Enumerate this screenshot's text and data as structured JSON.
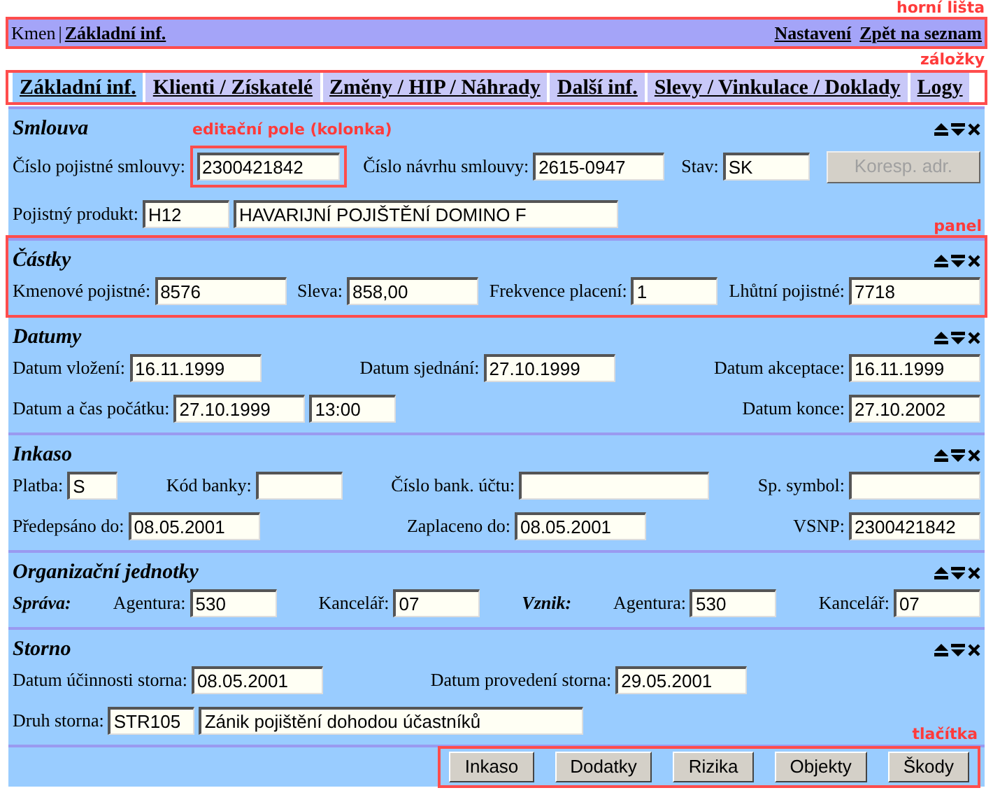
{
  "top_bar": {
    "annotation": "horní lišta",
    "crumbs": [
      {
        "text": "Kmen",
        "kind": "text"
      },
      {
        "text": "|",
        "kind": "text"
      },
      {
        "text": "Základní inf.",
        "kind": "link"
      }
    ],
    "links": [
      "Nastavení",
      "Zpět na seznam"
    ]
  },
  "tabs": {
    "annotation": "záložky",
    "items": [
      {
        "label": "Základní inf.",
        "selected": true
      },
      {
        "label": "Klienti / Získatelé",
        "selected": false
      },
      {
        "label": "Změny / HIP / Náhrady",
        "selected": false
      },
      {
        "label": "Další inf.",
        "selected": false
      },
      {
        "label": "Slevy / Vinkulace / Doklady",
        "selected": false
      },
      {
        "label": "Logy",
        "selected": false
      }
    ]
  },
  "panels": [
    {
      "title": "Smlouva",
      "rows": [
        {
          "items": [
            {
              "kind": "field",
              "label": "Číslo pojistné smlouvy:",
              "inputs": [
                {
                  "value": "2300421842",
                  "kind": "long",
                  "annotation": "editační pole (kolonka)"
                }
              ]
            },
            {
              "kind": "field",
              "label": "Číslo návrhu smlouvy:",
              "inputs": [
                {
                  "value": "2615-0947",
                  "kind": "medium"
                }
              ]
            },
            {
              "kind": "field",
              "label": "Stav:",
              "inputs": [
                {
                  "value": "SK",
                  "kind": "short"
                }
              ]
            },
            {
              "kind": "button",
              "label": "Koresp. adr.",
              "disabled": true
            }
          ]
        },
        {
          "items": [
            {
              "kind": "field",
              "label": "Pojistný produkt:",
              "inputs": [
                {
                  "value": "H12",
                  "kind": "short"
                },
                {
                  "value": "HAVARIJNÍ POJIŠTĚNÍ DOMINO F",
                  "kind": "full"
                }
              ]
            }
          ]
        }
      ]
    },
    {
      "title": "Částky",
      "annotation": "panel",
      "rows": [
        {
          "items": [
            {
              "kind": "field",
              "label": "Kmenové pojistné:",
              "inputs": [
                {
                  "value": "8576",
                  "kind": "medium"
                }
              ]
            },
            {
              "kind": "field",
              "label": "Sleva:",
              "inputs": [
                {
                  "value": "858,00",
                  "kind": "medium"
                }
              ]
            },
            {
              "kind": "field",
              "label": "Frekvence placení:",
              "inputs": [
                {
                  "value": "1",
                  "kind": "short"
                }
              ]
            },
            {
              "kind": "field",
              "label": "Lhůtní pojistné:",
              "inputs": [
                {
                  "value": "7718",
                  "kind": "medium"
                }
              ]
            }
          ]
        }
      ]
    },
    {
      "title": "Datumy",
      "rows": [
        {
          "items": [
            {
              "kind": "field",
              "label": "Datum vložení:",
              "inputs": [
                {
                  "value": "16.11.1999",
                  "kind": "medium"
                }
              ]
            },
            {
              "kind": "field",
              "label": "Datum sjednání:",
              "inputs": [
                {
                  "value": "27.10.1999",
                  "kind": "medium"
                }
              ]
            },
            {
              "kind": "field",
              "label": "Datum akceptace:",
              "inputs": [
                {
                  "value": "16.11.1999",
                  "kind": "medium"
                }
              ]
            }
          ]
        },
        {
          "items": [
            {
              "kind": "field",
              "label": "Datum a čas počátku:",
              "inputs": [
                {
                  "value": "27.10.1999",
                  "kind": "medium"
                },
                {
                  "value": "13:00",
                  "kind": "short"
                }
              ]
            },
            {
              "kind": "field",
              "label": "Datum konce:",
              "inputs": [
                {
                  "value": "27.10.2002",
                  "kind": "medium"
                }
              ]
            }
          ]
        }
      ]
    },
    {
      "title": "Inkaso",
      "rows": [
        {
          "items": [
            {
              "kind": "field",
              "label": "Platba:",
              "inputs": [
                {
                  "value": "S",
                  "kind": "tiny"
                }
              ]
            },
            {
              "kind": "field",
              "label": "Kód banky:",
              "inputs": [
                {
                  "kind": "short"
                }
              ]
            },
            {
              "kind": "field",
              "label": "Číslo bank. účtu:",
              "inputs": [
                {
                  "kind": "wide"
                }
              ]
            },
            {
              "kind": "field",
              "label": "Sp. symbol:",
              "inputs": [
                {
                  "kind": "medium"
                }
              ]
            }
          ]
        },
        {
          "items": [
            {
              "kind": "field",
              "label": "Předepsáno do:",
              "inputs": [
                {
                  "value": "08.05.2001",
                  "kind": "medium"
                }
              ]
            },
            {
              "kind": "field",
              "label": "Zaplaceno do:",
              "inputs": [
                {
                  "value": "08.05.2001",
                  "kind": "medium"
                }
              ]
            },
            {
              "kind": "field",
              "label": "VSNP:",
              "inputs": [
                {
                  "value": "2300421842",
                  "kind": "medium"
                }
              ]
            }
          ]
        }
      ]
    },
    {
      "title": "Organizační jednotky",
      "rows": [
        {
          "items": [
            {
              "kind": "heading",
              "label": "Správa:"
            },
            {
              "kind": "field",
              "label": "Agentura:",
              "inputs": [
                {
                  "value": "530",
                  "kind": "short"
                }
              ]
            },
            {
              "kind": "field",
              "label": "Kancelář:",
              "inputs": [
                {
                  "value": "07",
                  "kind": "short"
                }
              ]
            },
            {
              "kind": "heading",
              "label": "Vznik:"
            },
            {
              "kind": "field",
              "label": "Agentura:",
              "inputs": [
                {
                  "value": "530",
                  "kind": "short"
                }
              ]
            },
            {
              "kind": "field",
              "label": "Kancelář:",
              "inputs": [
                {
                  "value": "07",
                  "kind": "short"
                }
              ]
            }
          ]
        }
      ]
    },
    {
      "title": "Storno",
      "rows": [
        {
          "items": [
            {
              "kind": "field",
              "label": "Datum účinnosti storna:",
              "inputs": [
                {
                  "value": "08.05.2001",
                  "kind": "medium"
                }
              ]
            },
            {
              "kind": "field",
              "label": "Datum provedení storna:",
              "inputs": [
                {
                  "value": "29.05.2001",
                  "kind": "medium"
                }
              ]
            },
            {
              "kind": "spacer"
            }
          ]
        },
        {
          "items": [
            {
              "kind": "field",
              "label": "Druh storna:",
              "inputs": [
                {
                  "value": "STR105",
                  "kind": "short"
                },
                {
                  "value": "Zánik pojištění dohodou účastníků",
                  "kind": "full"
                }
              ]
            }
          ]
        }
      ]
    }
  ],
  "buttons": {
    "annotation": "tlačítka",
    "items": [
      "Inkaso",
      "Dodatky",
      "Rizika",
      "Objekty",
      "Škody"
    ]
  }
}
